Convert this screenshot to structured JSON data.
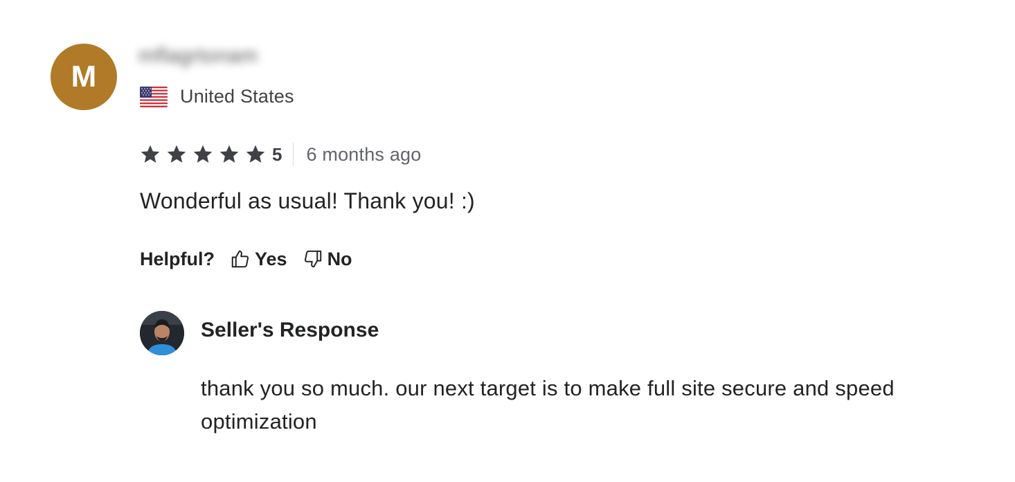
{
  "review": {
    "avatar_initial": "M",
    "avatar_color": "#b07a28",
    "username": "mflagrtonam",
    "country": "United States",
    "flag_icon": "us-flag-icon",
    "rating": "5",
    "star_color": "#404145",
    "star_count": 5,
    "time_ago": "6 months ago",
    "text": "Wonderful as usual! Thank you! :)",
    "helpful_label": "Helpful?",
    "yes_label": "Yes",
    "no_label": "No"
  },
  "seller_response": {
    "title": "Seller's Response",
    "text": "thank you so much. our next target is to make full site secure and speed optimization"
  }
}
